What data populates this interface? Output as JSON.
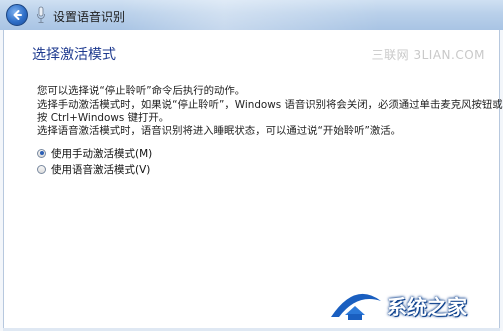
{
  "window": {
    "title": "设置语音识别"
  },
  "icons": {
    "back": "back-arrow-icon",
    "mic": "microphone-icon"
  },
  "page": {
    "heading": "选择激活模式",
    "watermark": "三联网 3LIAN.COM",
    "description_lines": [
      "您可以选择说“停止聆听”命令后执行的动作。",
      "选择手动激活模式时，如果说“停止聆听”，Windows 语音识别将会关闭，必须通过单击麦克风按钮或",
      "按 Ctrl+Windows 键打开。",
      "选择语音激活模式时，语音识别将进入睡眠状态，可以通过说“开始聆听”激活。"
    ]
  },
  "options": [
    {
      "label": "使用手动激活模式(M)",
      "checked": true
    },
    {
      "label": "使用语音激活模式(V)",
      "checked": false
    }
  ],
  "branding": {
    "logo_text": "系统之家",
    "colors": {
      "accent": "#1e3a8f",
      "logo_blue": "#0b3f8c"
    }
  }
}
